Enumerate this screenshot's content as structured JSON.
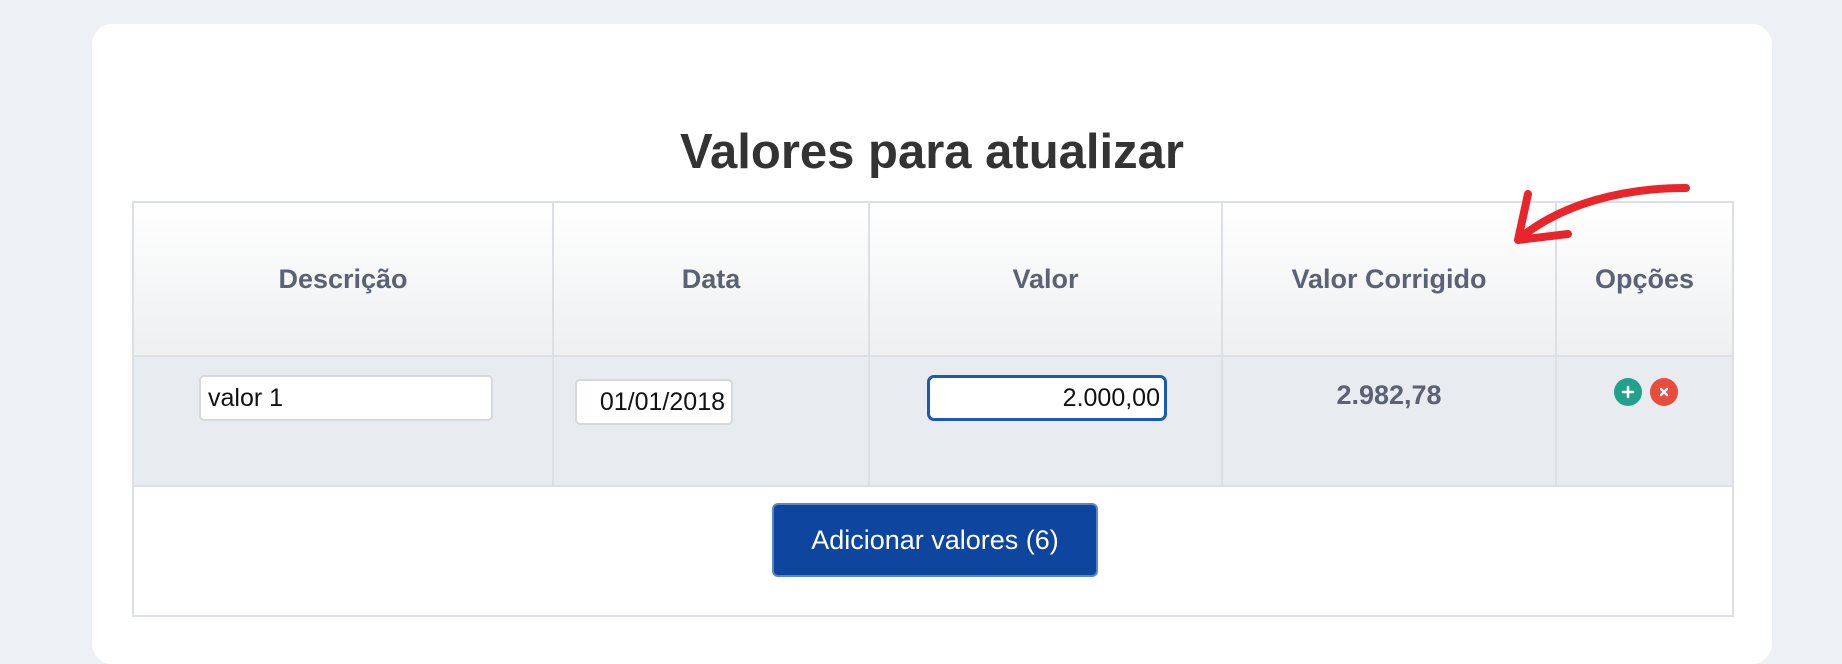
{
  "page": {
    "title": "Valores para atualizar"
  },
  "table": {
    "headers": {
      "descricao": "Descrição",
      "data": "Data",
      "valor": "Valor",
      "valor_corrigido": "Valor Corrigido",
      "opcoes": "Opções"
    },
    "rows": [
      {
        "descricao": "valor 1",
        "data": "01/01/2018",
        "valor": "2.000,00",
        "valor_corrigido": "2.982,78"
      }
    ]
  },
  "footer": {
    "add_values_label": "Adicionar valores (6)"
  },
  "icons": {
    "add_row": "plus-icon",
    "remove_row": "close-icon",
    "annotation": "arrow-annotation"
  },
  "colors": {
    "primary_button": "#0e469f",
    "add_icon": "#21a08c",
    "remove_icon": "#e84c3d",
    "annotation_arrow": "#e8252b",
    "focused_input_border": "#1a59b8"
  }
}
